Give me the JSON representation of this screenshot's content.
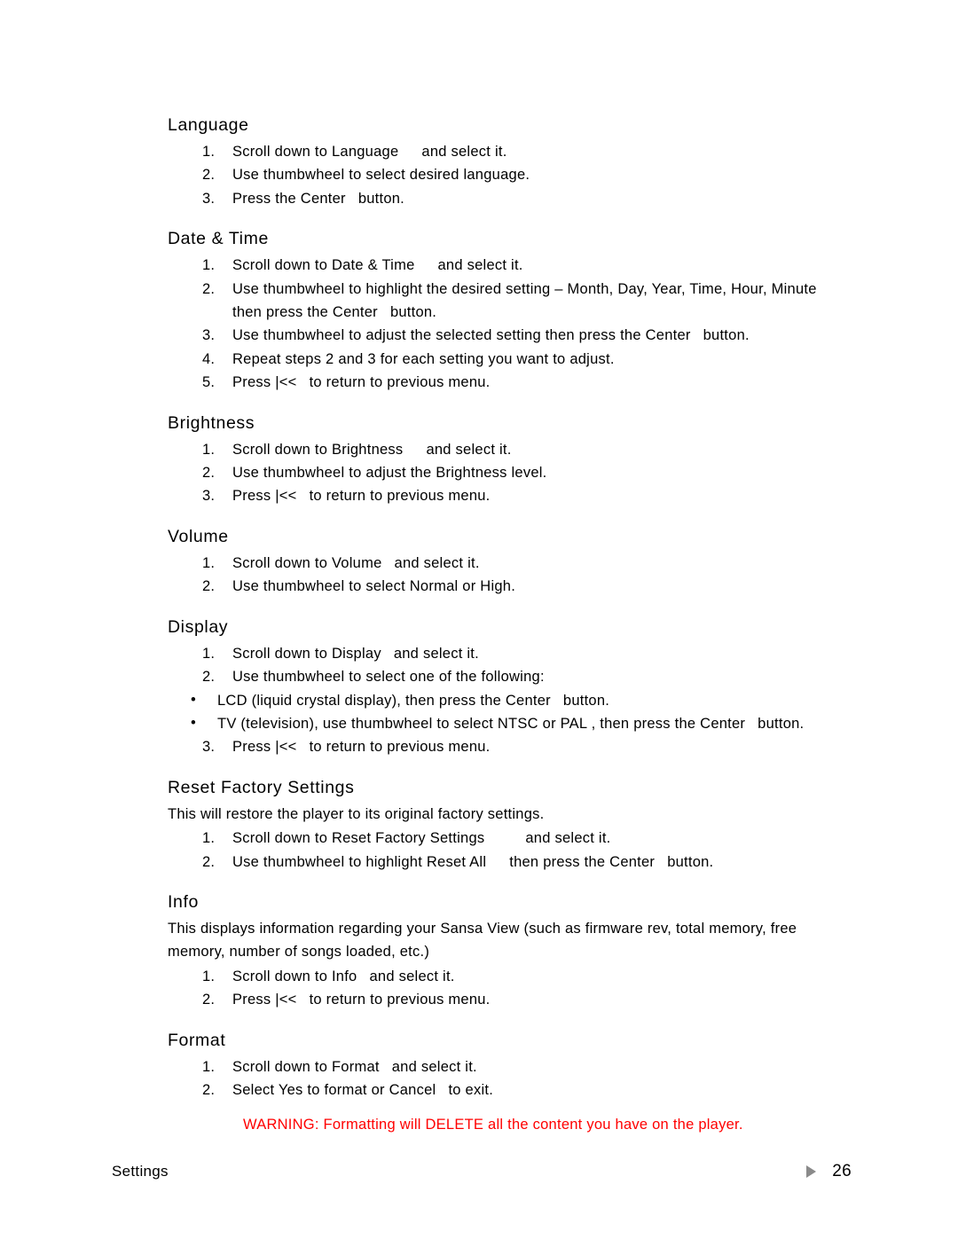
{
  "document": {
    "footer": {
      "section_label": "Settings",
      "page_number": "26",
      "marker_icon": "triangle-right-icon"
    },
    "warning_color": "#FF0000"
  },
  "sections": [
    {
      "id": "language",
      "heading": "Language",
      "steps": [
        {
          "num": "1.",
          "a": "Scroll down to Language",
          "b": "and select it."
        },
        {
          "num": "2.",
          "a": "Use thumbwheel to select desired language.",
          "b": ""
        },
        {
          "num": "3.",
          "a": "Press the Center",
          "b": "button."
        }
      ]
    },
    {
      "id": "date-time",
      "heading": "Date & Time",
      "steps": [
        {
          "num": "1.",
          "a": "Scroll down to Date & Time",
          "b": "and select it."
        },
        {
          "num": "2.",
          "a": "Use thumbwheel to highlight the desired setting – Month, Day, Year, Time, Hour, Minute",
          "b": "then press the Center",
          "c": "button."
        },
        {
          "num": "3.",
          "a": "Use thumbwheel to adjust the selected setting then press the Center",
          "b": "button."
        },
        {
          "num": "4.",
          "a": "Repeat steps 2 and 3 for each setting you want to adjust.",
          "b": ""
        },
        {
          "num": "5.",
          "a": "Press |<<",
          "b": "to return to previous menu."
        }
      ]
    },
    {
      "id": "brightness",
      "heading": "Brightness",
      "steps": [
        {
          "num": "1.",
          "a": "Scroll down to Brightness",
          "b": "and select it."
        },
        {
          "num": "2.",
          "a": "Use thumbwheel to adjust the Brightness level.",
          "b": ""
        },
        {
          "num": "3.",
          "a": "Press |<<",
          "b": "to return to previous menu."
        }
      ]
    },
    {
      "id": "volume",
      "heading": "Volume",
      "steps": [
        {
          "num": "1.",
          "a": "Scroll down to Volume",
          "b": "and select it."
        },
        {
          "num": "2.",
          "a": "Use thumbwheel to select Normal or High.",
          "b": ""
        }
      ]
    },
    {
      "id": "display",
      "heading": "Display",
      "steps": [
        {
          "num": "1.",
          "a": "Scroll down to Display",
          "b": "and select it."
        },
        {
          "num": "2.",
          "a": "Use thumbwheel to select one of the following:",
          "b": ""
        },
        {
          "num": "3.",
          "a": "Press |<<",
          "b": "to return to previous menu."
        }
      ],
      "bullets": [
        {
          "marker": "•",
          "a": "LCD (liquid crystal display), then press the Center",
          "b": "button."
        },
        {
          "marker": "•",
          "a": "TV (television), use thumbwheel to select NTSC or PAL , then press the Center",
          "b": "button."
        }
      ]
    },
    {
      "id": "reset-factory-settings",
      "heading": "Reset Factory Settings",
      "intro": "This will restore the player to its original factory settings.",
      "steps": [
        {
          "num": "1.",
          "a": "Scroll down to Reset Factory Settings",
          "b": "and select it."
        },
        {
          "num": "2.",
          "a": "Use thumbwheel to highlight Reset All",
          "b": "then press the Center",
          "c": "button."
        }
      ]
    },
    {
      "id": "info",
      "heading": "Info",
      "intro": "This displays information regarding your Sansa View (such as firmware rev, total memory, free memory, number of songs loaded, etc.)",
      "steps": [
        {
          "num": "1.",
          "a": "Scroll down to Info",
          "b": "and select it."
        },
        {
          "num": "2.",
          "a": "Press |<<",
          "b": "to return to previous menu."
        }
      ]
    },
    {
      "id": "format",
      "heading": "Format",
      "steps": [
        {
          "num": "1.",
          "a": "Scroll down to Format",
          "b": "and select it."
        },
        {
          "num": "2.",
          "a": "Select Yes to format or Cancel",
          "b": "to exit."
        }
      ],
      "warning": "WARNING:  Formatting will DELETE all the content you have on the player."
    }
  ]
}
